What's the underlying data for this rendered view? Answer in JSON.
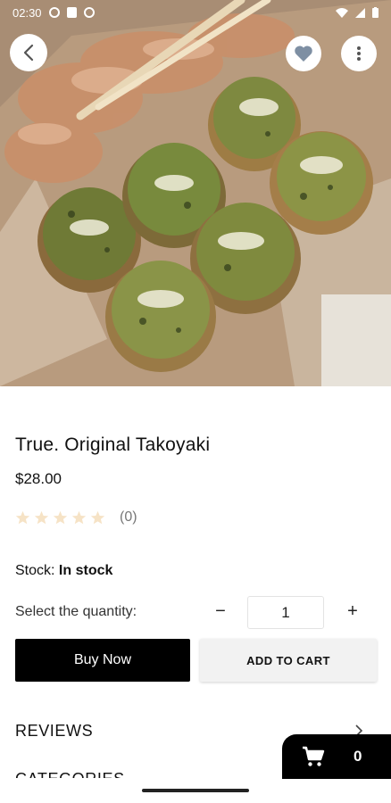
{
  "status_bar": {
    "time": "02:30"
  },
  "hero": {
    "image_alt": "Takoyaki in a paper box"
  },
  "product": {
    "title": "True. Original Takoyaki",
    "price": "$28.00",
    "rating_value": 0,
    "rating_count": "(0)",
    "stock_label": "Stock:",
    "stock_value": "In stock",
    "quantity_label": "Select the quantity:",
    "quantity": "1",
    "minus": "−",
    "plus": "+"
  },
  "actions": {
    "buy_now": "Buy Now",
    "add_to_cart": "ADD TO CART"
  },
  "sections": {
    "reviews": "REVIEWS",
    "categories": "CATEGORIES"
  },
  "cart": {
    "count": "0"
  },
  "colors": {
    "primary": "#000000",
    "secondary_button": "#f2f2f2",
    "star_empty": "#f6e3c6",
    "favorite_icon": "#7e8fa3"
  }
}
